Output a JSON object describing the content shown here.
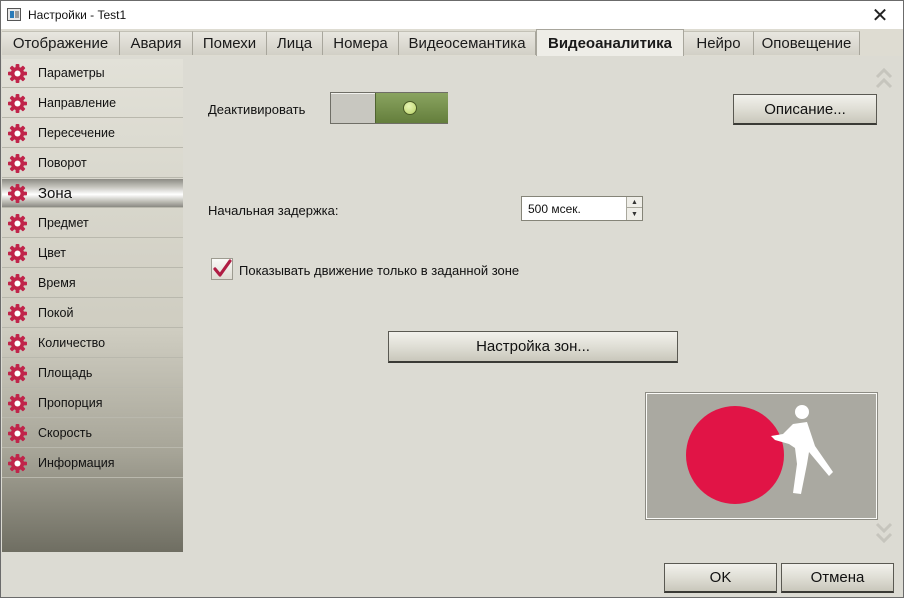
{
  "window": {
    "title": "Настройки - Test1"
  },
  "tabs": [
    {
      "label": "Отображение",
      "active": false
    },
    {
      "label": "Авария",
      "active": false
    },
    {
      "label": "Помехи",
      "active": false
    },
    {
      "label": "Лица",
      "active": false
    },
    {
      "label": "Номера",
      "active": false
    },
    {
      "label": "Видеосемантика",
      "active": false
    },
    {
      "label": "Видеоаналитика",
      "active": true
    },
    {
      "label": "Нейро",
      "active": false
    },
    {
      "label": "Оповещение",
      "active": false
    }
  ],
  "sidebar": {
    "items": [
      {
        "label": "Параметры"
      },
      {
        "label": "Направление"
      },
      {
        "label": "Пересечение"
      },
      {
        "label": "Поворот"
      },
      {
        "label": "Зона",
        "selected": true
      },
      {
        "label": "Предмет"
      },
      {
        "label": "Цвет"
      },
      {
        "label": "Время"
      },
      {
        "label": "Покой"
      },
      {
        "label": "Количество"
      },
      {
        "label": "Площадь"
      },
      {
        "label": "Пропорция"
      },
      {
        "label": "Скорость"
      },
      {
        "label": "Информация"
      }
    ],
    "icon": "gear-icon",
    "icon_color": "#c0244a"
  },
  "content": {
    "deactivate_label": "Деактивировать",
    "deactivate_on": true,
    "description_button": "Описание...",
    "initial_delay_label": "Начальная задержка:",
    "initial_delay_value": "500 мсек.",
    "show_motion_label": "Показывать движение только в заданной зоне",
    "show_motion_checked": true,
    "zones_button": "Настройка зон...",
    "preview_circle_color": "#e11446"
  },
  "footer": {
    "ok": "OK",
    "cancel": "Отмена"
  }
}
